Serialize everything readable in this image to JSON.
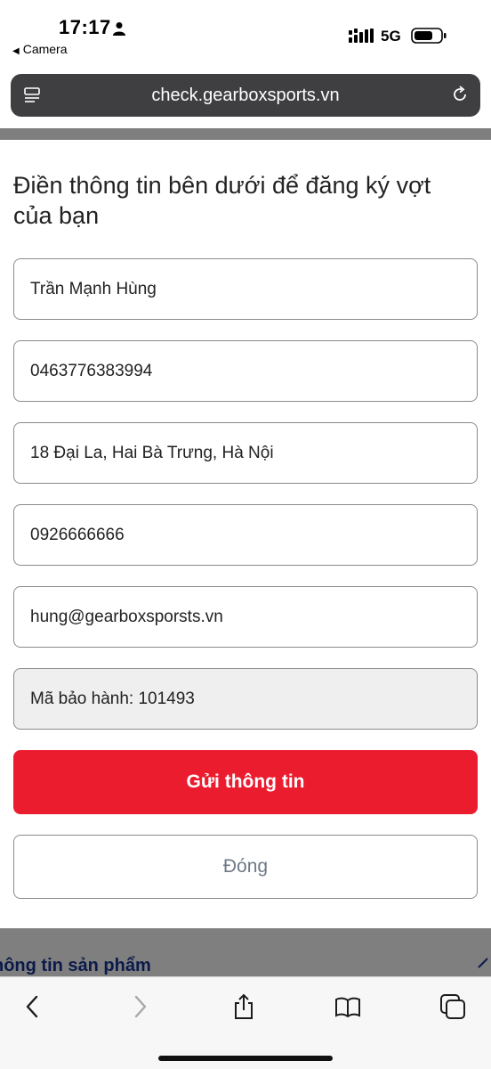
{
  "status_bar": {
    "time": "17:17",
    "back_app": "Camera",
    "network": "5G"
  },
  "browser": {
    "url": "check.gearboxsports.vn"
  },
  "form": {
    "title": "Điền thông tin bên dưới để đăng ký vợt của bạn",
    "fields": [
      {
        "value": "Trần Mạnh Hùng"
      },
      {
        "value": "0463776383994"
      },
      {
        "value": "18 Đại La, Hai Bà Trưng, Hà Nội"
      },
      {
        "value": "0926666666"
      },
      {
        "value": "hung@gearboxsporsts.vn"
      },
      {
        "value": "Mã bảo hành: 101493"
      }
    ],
    "submit_label": "Gửi thông tin",
    "close_label": "Đóng"
  },
  "background_page": {
    "section_heading": "hông tin sản phẩm"
  },
  "colors": {
    "accent": "#ec1c2f",
    "urlbar": "#3f3f41",
    "overlay": "#7f7f7f"
  },
  "toolbar_icons": [
    "back-icon",
    "forward-icon",
    "share-icon",
    "bookmarks-icon",
    "tabs-icon"
  ]
}
